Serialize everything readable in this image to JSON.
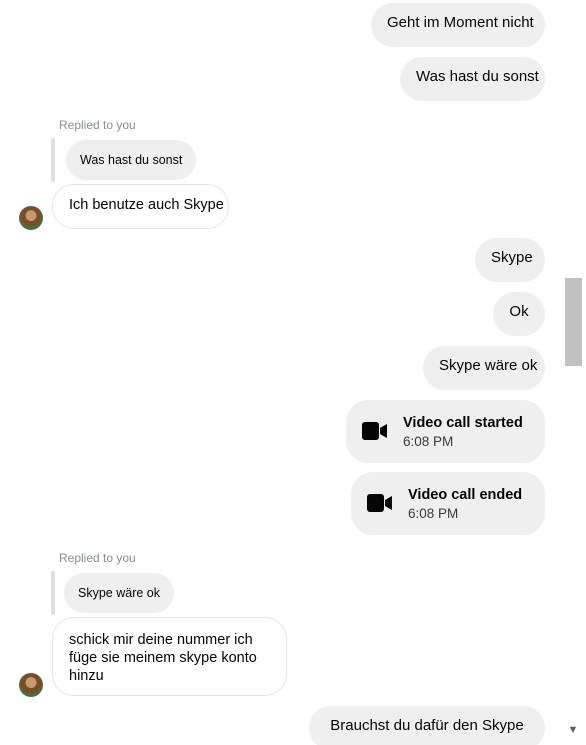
{
  "messages": {
    "out_1": "Geht im Moment nicht",
    "out_2": "Was hast du sonst",
    "reply_1": {
      "label": "Replied to you",
      "quote": "Was hast du sonst",
      "text": "Ich benutze auch Skype"
    },
    "out_3": "Skype",
    "out_4": "Ok",
    "out_5": "Skype wäre ok",
    "call_started": {
      "title": "Video call started",
      "time": "6:08 PM"
    },
    "call_ended": {
      "title": "Video call ended",
      "time": "6:08 PM"
    },
    "reply_2": {
      "label": "Replied to you",
      "quote": "Skype wäre ok",
      "text": "schick mir deine nummer ich füge sie meinem skype konto hinzu"
    },
    "out_6": "Brauchst du dafür den Skype"
  },
  "icons": {
    "video_call": "video-camera-icon",
    "scroll_down": "chevron-down-icon"
  },
  "colors": {
    "outgoing_bubble": "#efefef",
    "incoming_border": "#e4e6eb",
    "reply_label": "#8a8d91"
  }
}
